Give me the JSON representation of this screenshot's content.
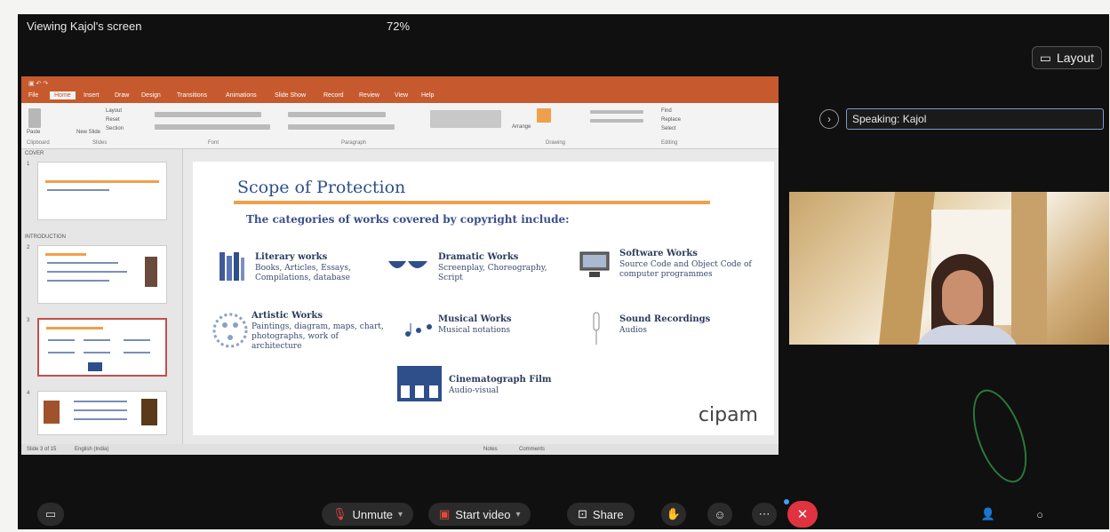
{
  "meeting": {
    "viewing_label": "Viewing Kajol's screen",
    "zoom_level": "72%",
    "layout_button": "Layout",
    "speaking_label": "Speaking: Kajol"
  },
  "ppt": {
    "active_tab": "Home",
    "ribbon_groups": [
      "Clipboard",
      "Slides",
      "Font",
      "Paragraph",
      "Drawing",
      "Editing"
    ],
    "ribbon_items": [
      "Paste",
      "Layout",
      "Reset",
      "New Slide",
      "Section",
      "Arrange",
      "Find",
      "Replace",
      "Select"
    ],
    "sections": [
      "COVER",
      "INTRODUCTION"
    ],
    "status_notes": "Notes",
    "status_comments": "Comments"
  },
  "slide": {
    "title": "Scope of Protection",
    "subtitle": "The categories of works covered by copyright include:",
    "works": [
      {
        "title": "Literary works",
        "desc": "Books, Articles, Essays, Compilations, database",
        "icon": "books-icon"
      },
      {
        "title": "Dramatic Works",
        "desc": "Screenplay, Choreography, Script",
        "icon": "masks-icon"
      },
      {
        "title": "Software Works",
        "desc": "Source Code and Object Code of computer programmes",
        "icon": "computer-icon"
      },
      {
        "title": "Artistic Works",
        "desc": "Paintings, diagram, maps, chart, photographs, work of architecture",
        "icon": "palette-icon"
      },
      {
        "title": "Musical Works",
        "desc": "Musical notations",
        "icon": "music-notes-icon"
      },
      {
        "title": "Sound Recordings",
        "desc": "Audios",
        "icon": "microphone-icon"
      },
      {
        "title": "Cinematograph Film",
        "desc": "Audio-visual",
        "icon": "film-icon"
      }
    ],
    "logo": "cipam"
  },
  "toolbar": {
    "unmute": "Unmute",
    "start_video": "Start video",
    "share": "Share"
  },
  "colors": {
    "accent_orange": "#f0a04b",
    "title_blue": "#2e4f8a",
    "ppt_orange": "#c65a2e",
    "end_call_red": "#e0333f"
  }
}
